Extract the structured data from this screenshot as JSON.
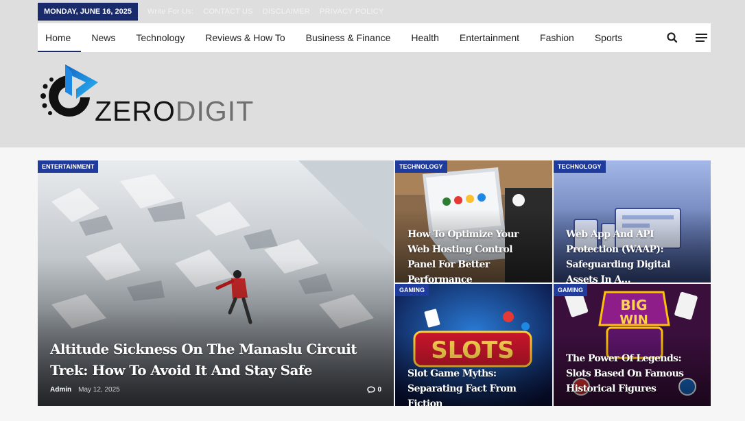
{
  "topbar": {
    "date": "MONDAY, JUNE 16, 2025",
    "links": [
      "Write For Us:",
      "CONTACT US",
      "DISCLAIMER",
      "PRIVACY POLICY"
    ]
  },
  "nav": {
    "items": [
      "Home",
      "News",
      "Technology",
      "Reviews & How To",
      "Business & Finance",
      "Health",
      "Entertainment",
      "Fashion",
      "Sports"
    ],
    "active": "Home",
    "icons": [
      "search-icon",
      "menu-icon"
    ]
  },
  "logo": {
    "part1": "ZERO",
    "part2": "DIGIT"
  },
  "featured": {
    "category": "ENTERTAINMENT",
    "title": "Altitude Sickness On The Manaslu Circuit Trek: How To Avoid It And Stay Safe",
    "author": "Admin",
    "date": "May 12, 2025",
    "comments": "0"
  },
  "cards": [
    {
      "category": "TECHNOLOGY",
      "title": "How To Optimize Your Web Hosting Control Panel For Better Performance"
    },
    {
      "category": "TECHNOLOGY",
      "title": "Web App And API Protection (WAAP): Safeguarding Digital Assets In A…"
    },
    {
      "category": "GAMING",
      "title": "Slot Game Myths: Separating Fact From Fiction"
    },
    {
      "category": "GAMING",
      "title": "The Power Of Legends: Slots Based On Famous Historical Figures"
    }
  ],
  "colors": {
    "brand_dark": "#1a2b6b",
    "badge": "#1f3b9b",
    "logo_blue": "#1e88e5"
  }
}
